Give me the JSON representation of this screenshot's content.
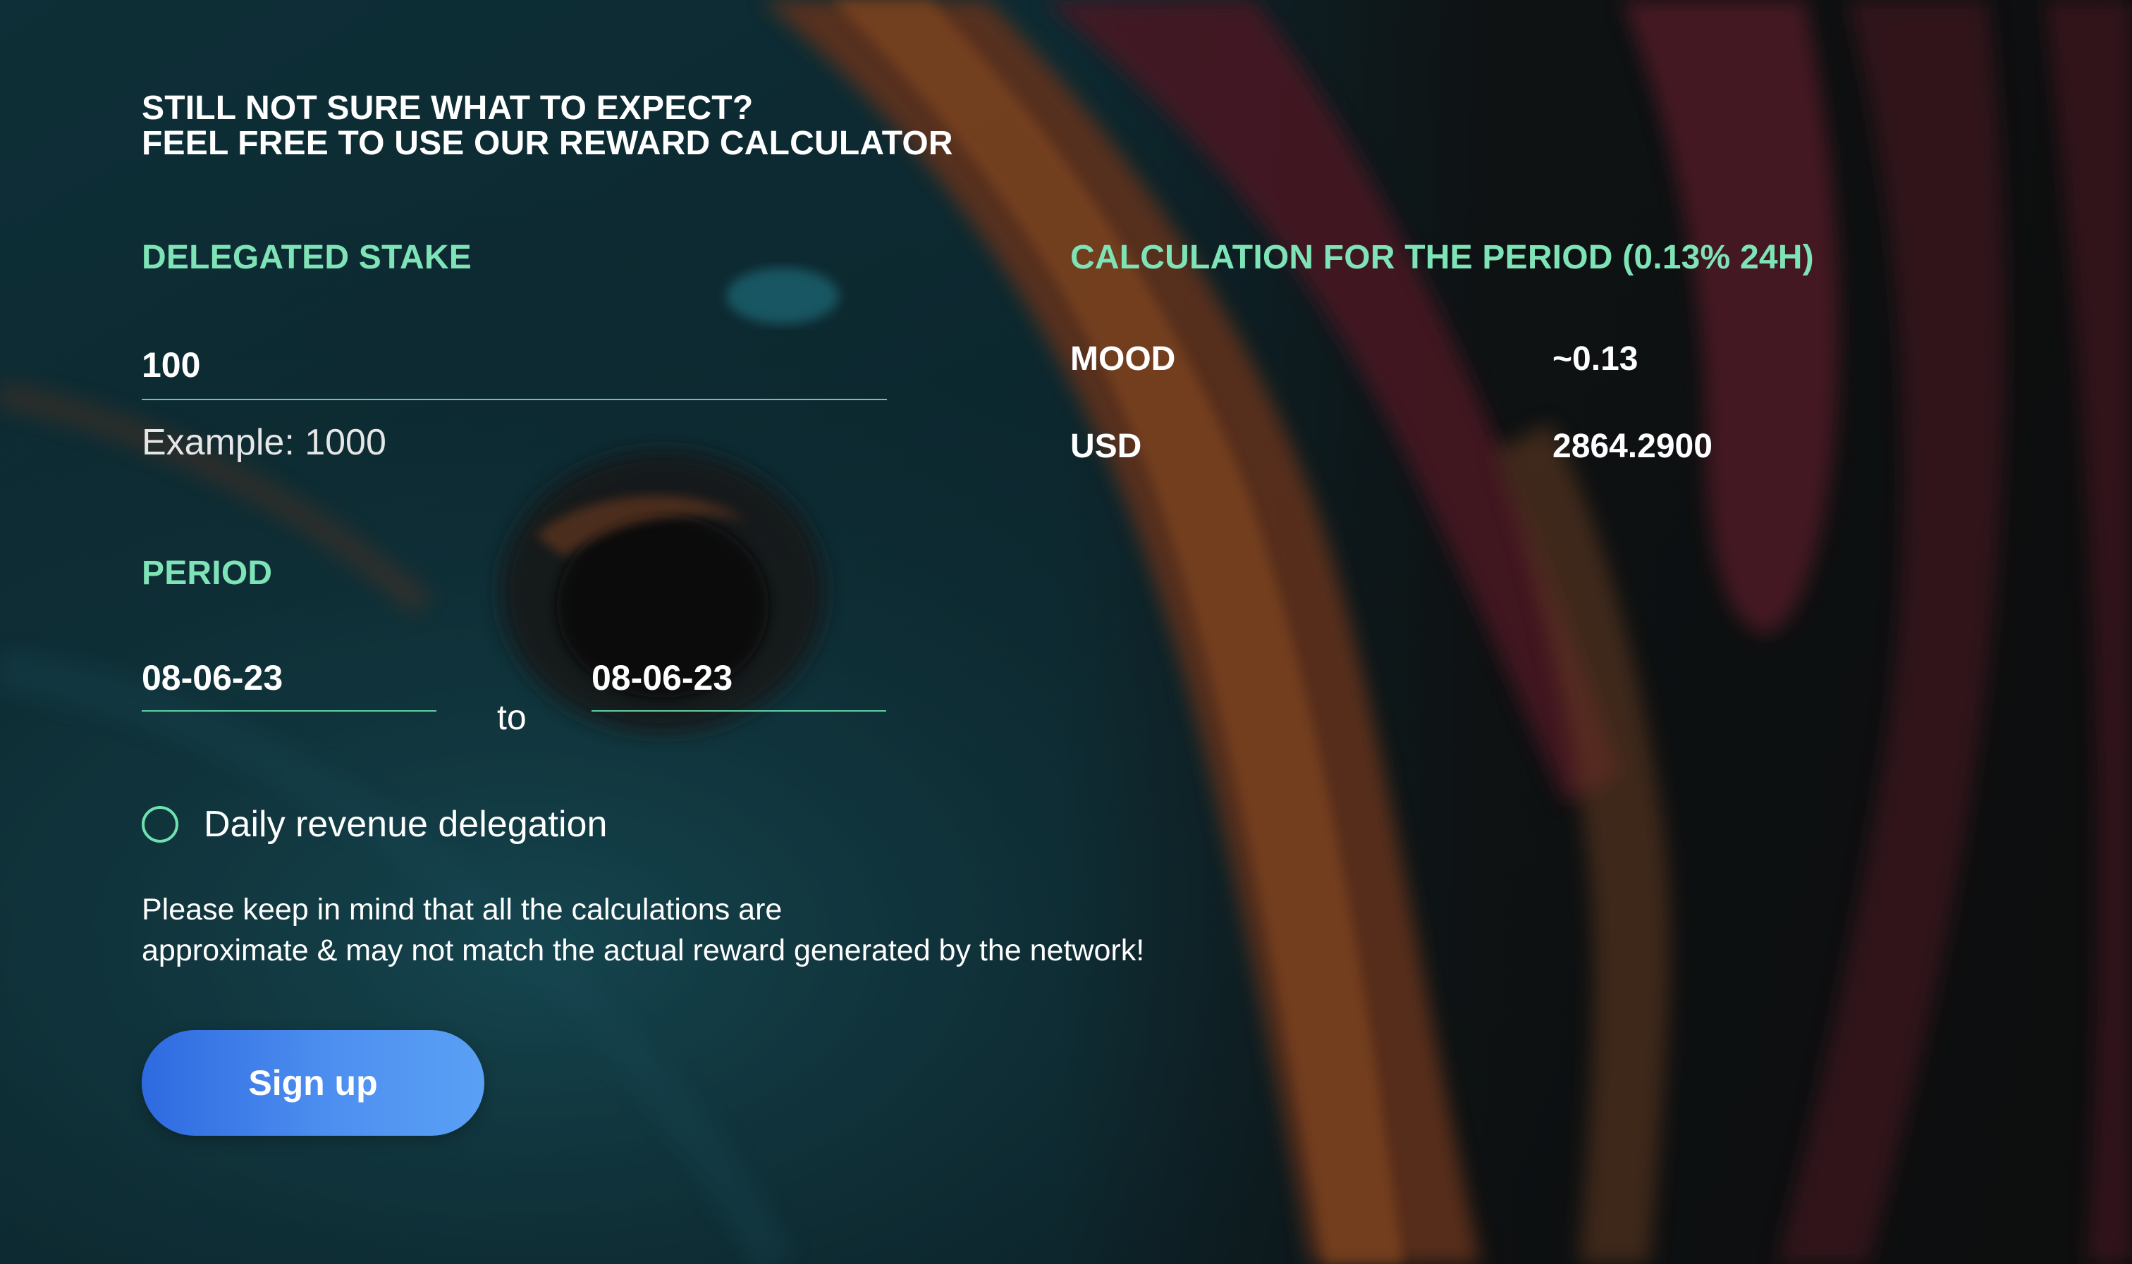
{
  "headline": {
    "line1": "STILL NOT SURE WHAT TO EXPECT?",
    "line2": "FEEL FREE TO USE OUR REWARD CALCULATOR"
  },
  "stake": {
    "title": "DELEGATED STAKE",
    "value": "100",
    "hint": "Example: 1000"
  },
  "period": {
    "title": "PERIOD",
    "from": "08-06-23",
    "to_label": "to",
    "to": "08-06-23"
  },
  "option": {
    "label": "Daily revenue delegation",
    "checked": false
  },
  "disclaimer": {
    "line1": "Please keep in mind that all the calculations are",
    "line2": "approximate & may not match the actual reward generated by the network!"
  },
  "button": {
    "label": "Sign up"
  },
  "results": {
    "title": "CALCULATION FOR THE PERIOD (0.13% 24H)",
    "rows": [
      {
        "label": "MOOD",
        "value": "~0.13"
      },
      {
        "label": "USD",
        "value": "2864.2900"
      }
    ]
  },
  "colors": {
    "accent": "#7ee3b6",
    "button_start": "#2e6ae0",
    "button_end": "#5aa0f5",
    "underline": "#5dd0a2"
  }
}
